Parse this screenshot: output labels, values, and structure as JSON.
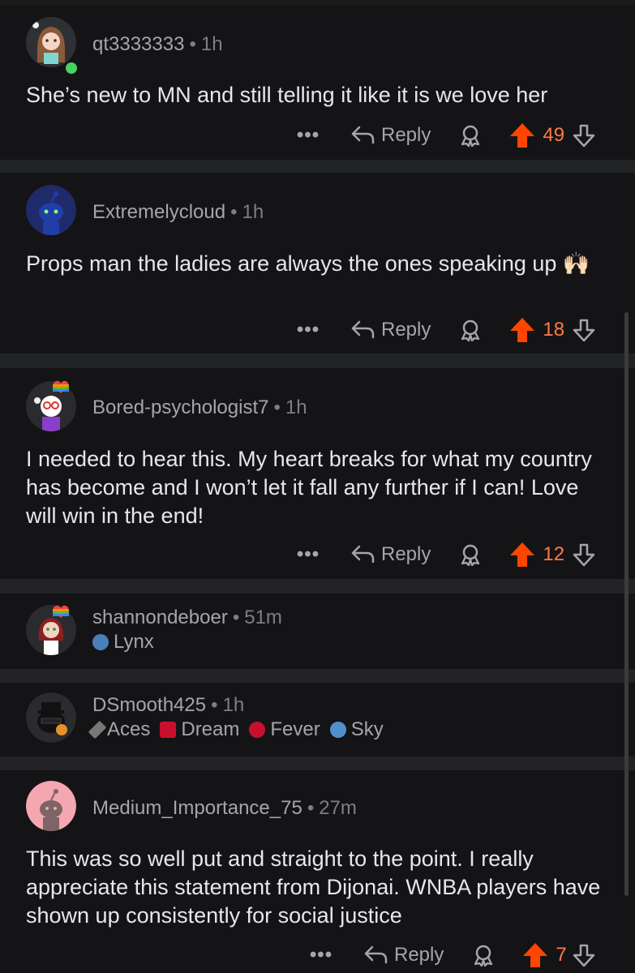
{
  "comments": [
    {
      "username": "qt3333333",
      "time": "1h",
      "text": "She’s new to MN and still telling it like it is we love her",
      "reply_label": "Reply",
      "score": "49",
      "more": "•••"
    },
    {
      "username": "Extremelycloud",
      "time": "1h",
      "text": "Props man the ladies are always the ones speaking up 🙌🏻",
      "reply_label": "Reply",
      "score": "18",
      "more": "•••"
    },
    {
      "username": "Bored-psychologist7",
      "time": "1h",
      "text": "I needed to hear this. My heart breaks for what my country has become and I won’t let it fall any further if I can! Love will win in the end!",
      "reply_label": "Reply",
      "score": "12",
      "more": "•••"
    },
    {
      "username": "shannondeboer",
      "time": "51m",
      "flair": [
        "Lynx"
      ]
    },
    {
      "username": "DSmooth425",
      "time": "1h",
      "flair": [
        "Aces",
        "Dream",
        "Fever",
        "Sky"
      ]
    },
    {
      "username": "Medium_Importance_75",
      "time": "27m",
      "text": "This was so well put and straight to the point. I really appreciate this statement from Dijonai. WNBA players have shown up consistently for social justice",
      "reply_label": "Reply",
      "score": "7",
      "more": "•••"
    }
  ],
  "colors": {
    "background": "#000000",
    "card": "#141416",
    "upvote": "#ff4500",
    "score": "#ff7a45",
    "online": "#46d160"
  },
  "icons": [
    "reply-arrow-icon",
    "award-icon",
    "upvote-arrow-icon",
    "downvote-arrow-icon",
    "more-dots-icon"
  ],
  "separator": "•"
}
